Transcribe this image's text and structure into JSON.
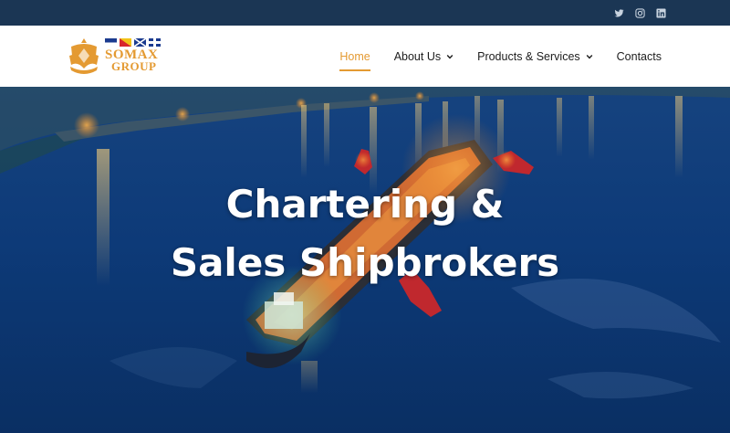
{
  "topbar": {
    "social": [
      {
        "icon": "twitter-icon"
      },
      {
        "icon": "instagram-icon"
      },
      {
        "icon": "linkedin-icon"
      }
    ]
  },
  "logo": {
    "line1": "SOMAX",
    "line2": "GROUP"
  },
  "nav": {
    "items": [
      {
        "label": "Home",
        "active": true
      },
      {
        "label": "About Us",
        "dropdown": true
      },
      {
        "label": "Products & Services",
        "dropdown": true
      },
      {
        "label": "Contacts"
      }
    ]
  },
  "hero": {
    "title_line1": "Chartering &",
    "title_line2": "Sales Shipbrokers"
  },
  "colors": {
    "accent": "#e49a32",
    "topbar": "#1b3654",
    "header_bg": "#ffffff",
    "sea": "#0b3b78"
  }
}
